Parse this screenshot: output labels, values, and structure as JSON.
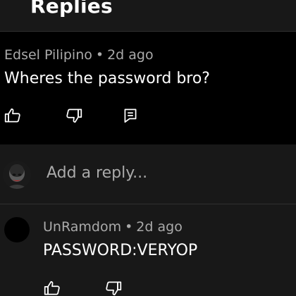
{
  "header": {
    "title": "Replies"
  },
  "comment": {
    "author": "Edsel Pilipino",
    "separator": "•",
    "time": "2d ago",
    "text": "Wheres the password bro?"
  },
  "reply_box": {
    "placeholder": "Add a reply..."
  },
  "reply": {
    "author": "UnRamdom",
    "separator": "•",
    "time": "2d ago",
    "text": "PASSWORD:VERYOP"
  },
  "icons": {
    "like": "thumbs-up-icon",
    "dislike": "thumbs-down-icon",
    "reply": "reply-icon"
  },
  "colors": {
    "background": "#181818",
    "comment_background": "#000000",
    "text_primary": "#ffffff",
    "text_secondary": "#aaaaaa"
  }
}
